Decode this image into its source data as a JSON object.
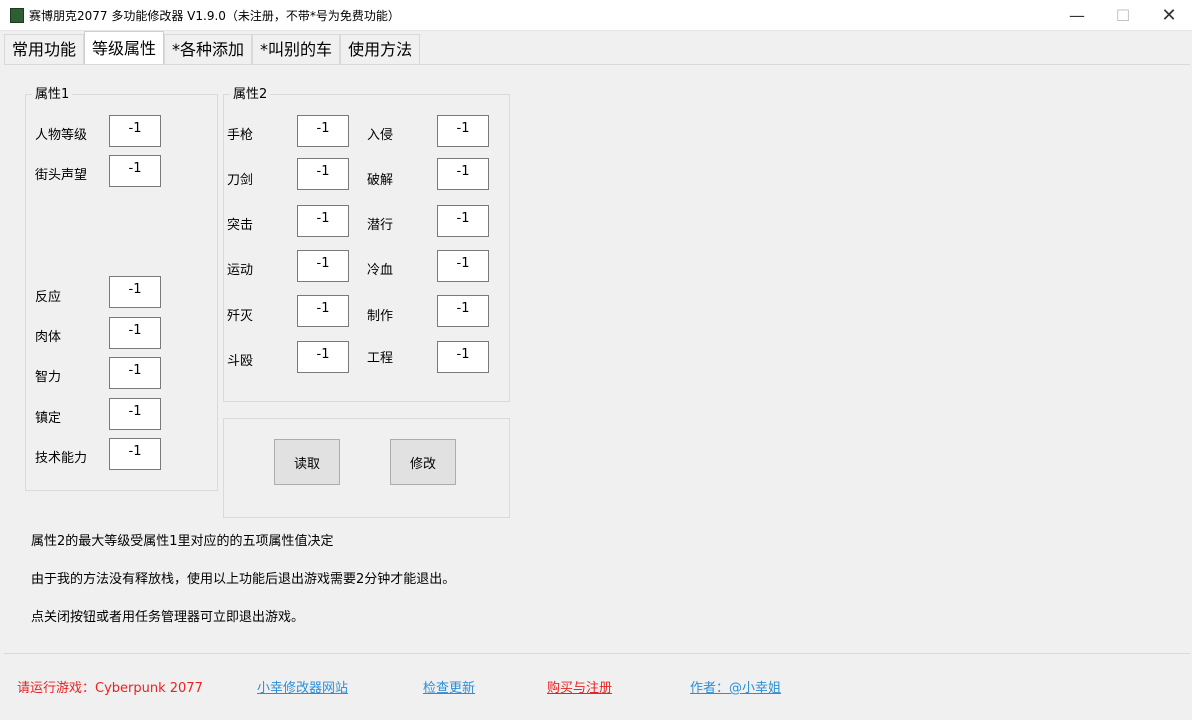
{
  "window": {
    "title": "赛博朋克2077 多功能修改器  V1.9.0（未注册，不带*号为免费功能）",
    "minimize_glyph": "—",
    "maximize_glyph": "☐",
    "close_glyph": "✕"
  },
  "tabs": [
    {
      "label": "常用功能",
      "active": false
    },
    {
      "label": "等级属性",
      "active": true
    },
    {
      "label": "*各种添加",
      "active": false
    },
    {
      "label": "*叫别的车",
      "active": false
    },
    {
      "label": "使用方法",
      "active": false
    }
  ],
  "group1": {
    "title": "属性1",
    "rows": [
      {
        "label": "人物等级",
        "value": "-1"
      },
      {
        "label": "街头声望",
        "value": "-1"
      },
      {
        "label": "反应",
        "value": "-1"
      },
      {
        "label": "肉体",
        "value": "-1"
      },
      {
        "label": "智力",
        "value": "-1"
      },
      {
        "label": "镇定",
        "value": "-1"
      },
      {
        "label": "技术能力",
        "value": "-1"
      }
    ]
  },
  "group2": {
    "title": "属性2",
    "left": [
      {
        "label": "手枪",
        "value": "-1"
      },
      {
        "label": "刀剑",
        "value": "-1"
      },
      {
        "label": "突击",
        "value": "-1"
      },
      {
        "label": "运动",
        "value": "-1"
      },
      {
        "label": "歼灭",
        "value": "-1"
      },
      {
        "label": "斗殴",
        "value": "-1"
      }
    ],
    "right": [
      {
        "label": "入侵",
        "value": "-1"
      },
      {
        "label": "破解",
        "value": "-1"
      },
      {
        "label": "潜行",
        "value": "-1"
      },
      {
        "label": "冷血",
        "value": "-1"
      },
      {
        "label": "制作",
        "value": "-1"
      },
      {
        "label": "工程",
        "value": "-1"
      }
    ]
  },
  "actions": {
    "read_label": "读取",
    "modify_label": "修改"
  },
  "notes": [
    "属性2的最大等级受属性1里对应的的五项属性值决定",
    "由于我的方法没有释放栈，使用以上功能后退出游戏需要2分钟才能退出。",
    "点关闭按钮或者用任务管理器可立即退出游戏。"
  ],
  "footer": {
    "status": "请运行游戏：Cyberpunk 2077",
    "website": "小幸修改器网站",
    "check_update": "检查更新",
    "buy_register": "购买与注册",
    "author": "作者：@小幸姐"
  },
  "colors": {
    "link_blue": "#2a8fd6",
    "alert_red": "#e82323"
  }
}
